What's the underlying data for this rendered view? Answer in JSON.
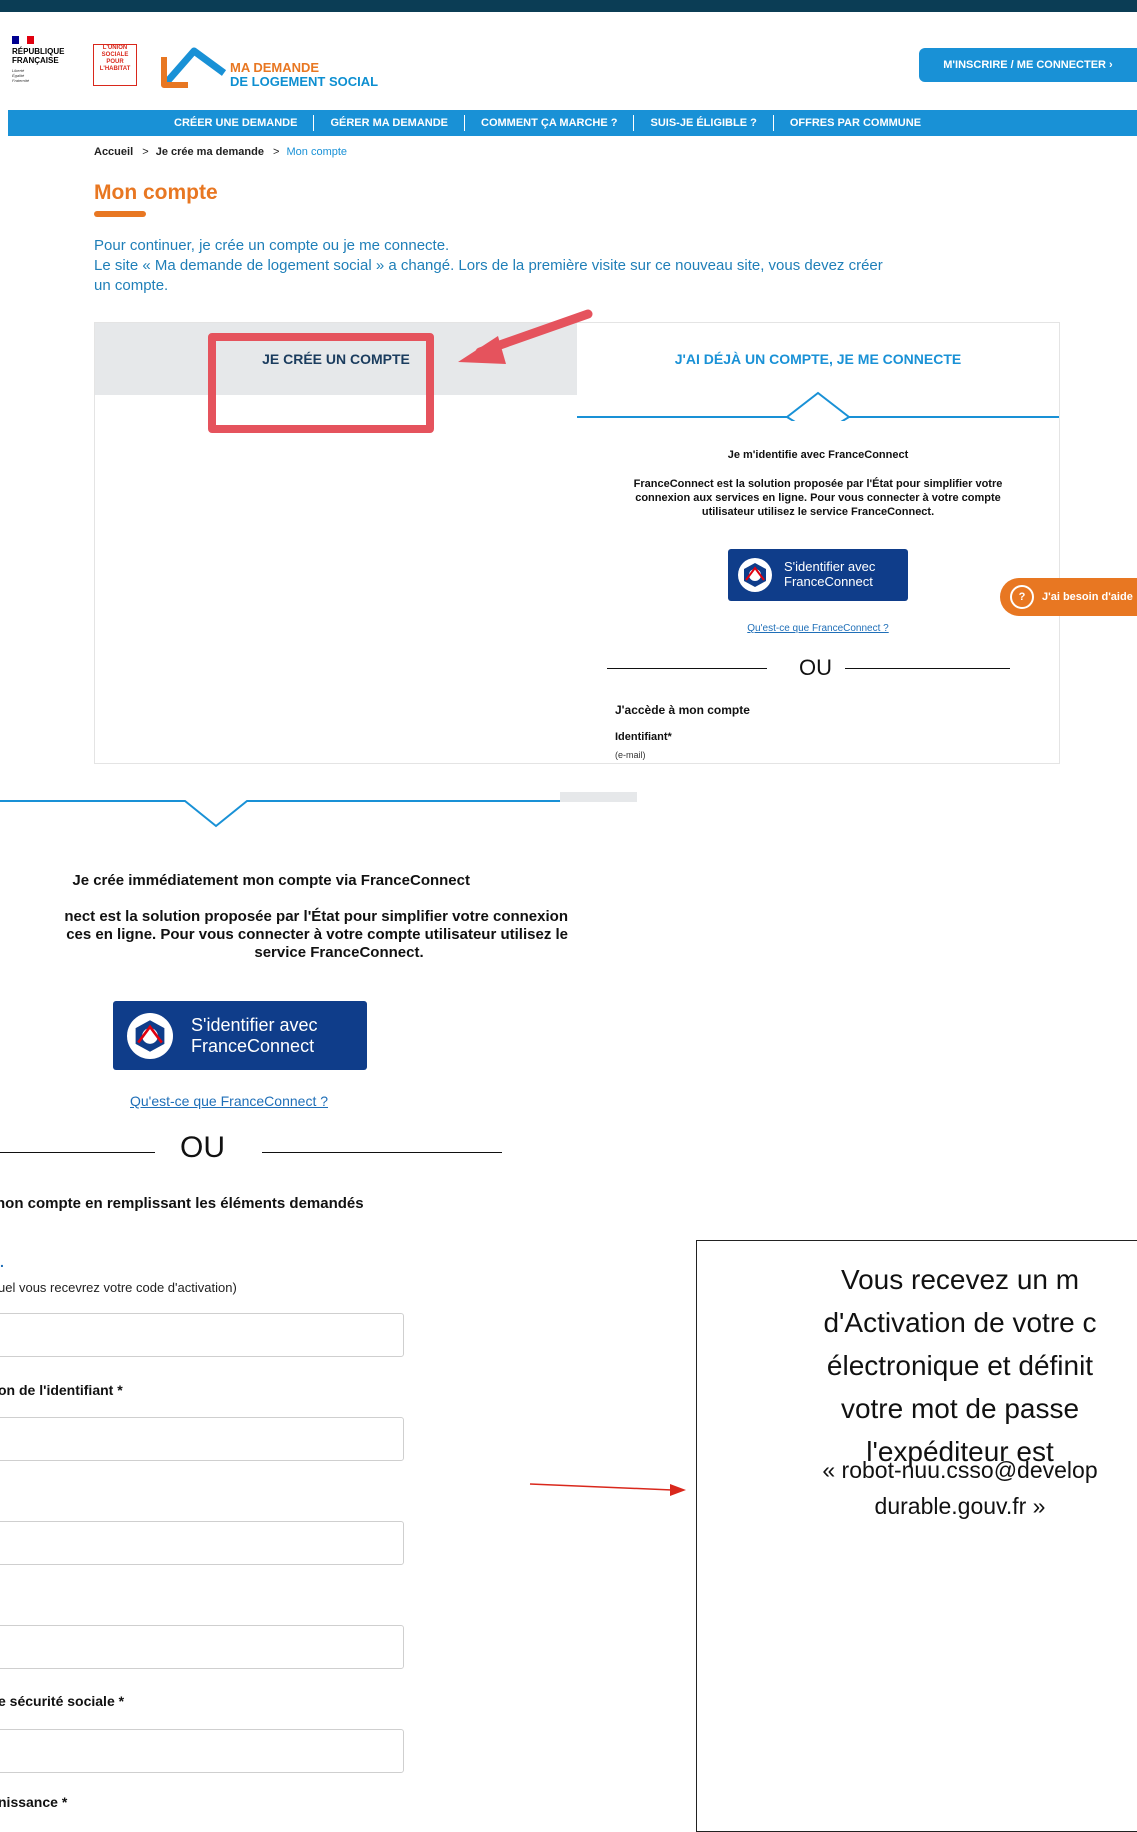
{
  "header": {
    "gov_label": "RÉPUBLIQUE\nFRANÇAISE",
    "gov_motto": "Liberté\nÉgalité\nFraternité",
    "partner_lines": [
      "L'UNION",
      "SOCIALE",
      "POUR",
      "L'HABITAT"
    ],
    "logo_line1": "MA DEMANDE",
    "logo_line2": "DE LOGEMENT SOCIAL",
    "login_button": "M'INSCRIRE / ME CONNECTER  ›"
  },
  "nav": {
    "items": [
      "CRÉER UNE DEMANDE",
      "GÉRER MA DEMANDE",
      "COMMENT ÇA MARCHE ?",
      "SUIS-JE ÉLIGIBLE ?",
      "OFFRES PAR COMMUNE"
    ]
  },
  "breadcrumb": {
    "home": "Accueil",
    "step": "Je crée ma demande",
    "current": "Mon compte",
    "separator": ">"
  },
  "page": {
    "title": "Mon compte",
    "intro_line1": "Pour continuer, je crée un compte ou je me connecte.",
    "intro_line2": "Le site « Ma demande de logement social » a changé. Lors de la première visite sur ce nouveau site, vous devez créer",
    "intro_line3": "un compte."
  },
  "tabs": {
    "create": "JE CRÉE UN COMPTE",
    "login": "J'AI DÉJÀ UN COMPTE, JE ME CONNECTE"
  },
  "login_panel": {
    "fc_title": "Je m'identifie avec FranceConnect",
    "fc_desc_lines": [
      "FranceConnect est la solution proposée par l'État pour simplifier votre",
      "connexion aux services en ligne. Pour vous connecter à votre compte",
      "utilisateur utilisez le service FranceConnect."
    ],
    "fc_button_line1": "S'identifier avec",
    "fc_button_line2": "FranceConnect",
    "fc_link": "Qu'est-ce que FranceConnect ?",
    "or_label": "OU",
    "access_title": "J'accède à mon compte",
    "identifier_label": "Identifiant*",
    "identifier_hint": "(e-mail)"
  },
  "help_button": "J'ai besoin d'aide",
  "create_panel": {
    "fc_title": "Je crée immédiatement mon compte via FranceConnect",
    "fc_desc_lines": [
      "nect est la solution proposée par l'État pour simplifier votre connexion",
      "ces en ligne. Pour vous connecter à votre compte utilisateur utilisez le",
      "service FranceConnect."
    ],
    "fc_button_line1": "S'identifier avec",
    "fc_button_line2": "FranceConnect",
    "fc_link": "Qu'est-ce que FranceConnect ?",
    "or_label": "OU",
    "form_title": "non compte en remplissant les éléments demandés",
    "dot_mark": ".",
    "field_hint": "uel vous recevrez votre code d'activation)",
    "confirm_label": "on de l'identifiant *",
    "ssn_label": "e sécurité sociale *",
    "birth_label": "nissance *"
  },
  "note": {
    "lines": [
      "Vous recevez un m",
      "d'Activation de votre c",
      "électronique et définit",
      "votre mot de passe",
      "l'expéditeur est"
    ],
    "email_lines": [
      "« robot-nuu.csso@develop",
      "durable.gouv.fr »"
    ]
  },
  "colors": {
    "brand_orange": "#e87722",
    "brand_blue": "#1991d6",
    "dark_navy": "#0b3d55",
    "highlight_red": "#e5535d",
    "franceconnect_blue": "#0f3d8a"
  }
}
